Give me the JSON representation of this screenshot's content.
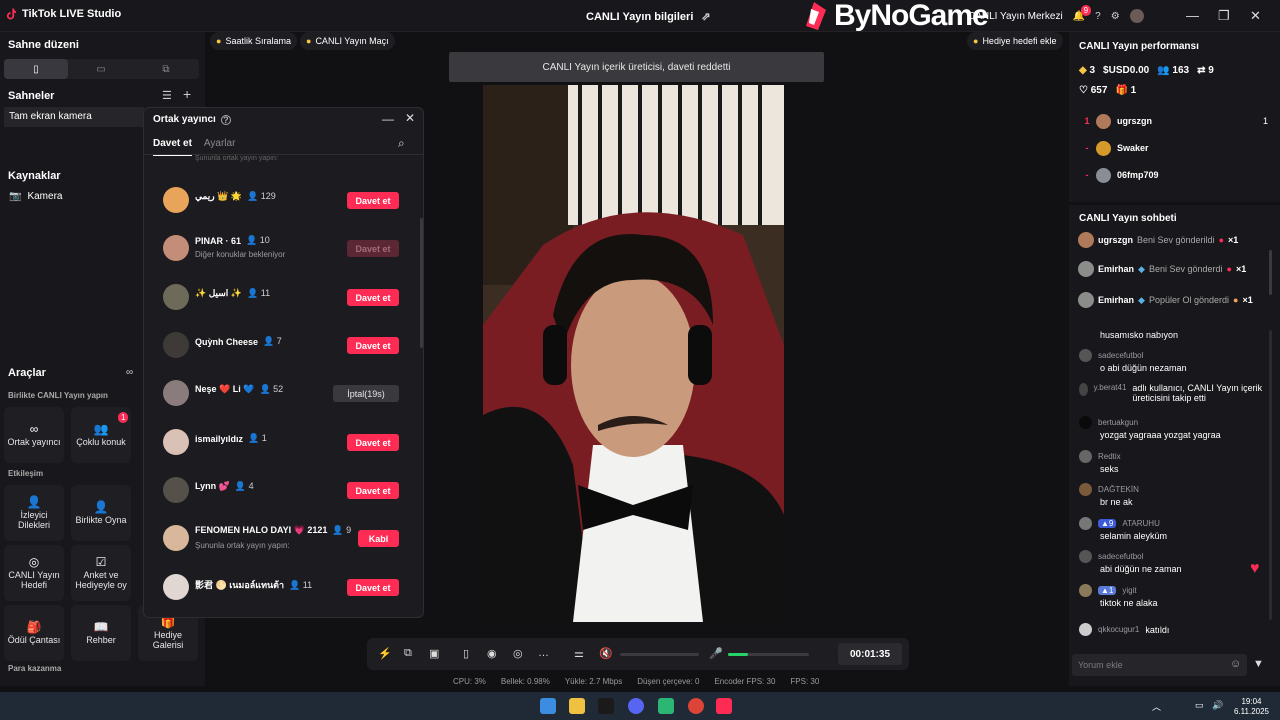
{
  "app": {
    "title": "TikTok LIVE Studio"
  },
  "header": {
    "center_title": "CANLI Yayın bilgileri",
    "brand": "ByNoGame",
    "live_center": "CANLI Yayın Merkezi",
    "notification_count": "9"
  },
  "left": {
    "scene_layout_title": "Sahne düzeni",
    "scenes_title": "Sahneler",
    "scene_item": "Tam ekran kamera",
    "sources_title": "Kaynaklar",
    "source_item": "Kamera",
    "tools_title": "Araçlar",
    "tools_hint": "∞",
    "live_together_title": "Birlikte CANLI Yayın yapın",
    "engagement_title": "Etkileşim",
    "earn_title": "Para kazanma",
    "tools": {
      "cohost": "Ortak yayıncı",
      "multi_guest": "Çoklu konuk",
      "multi_guest_badge": "1",
      "viewer_requests": "İzleyici Dilekleri",
      "play_together": "Birlikte Oyna",
      "live_goal": "CANLI Yayın Hedefi",
      "poll_gift": "Anket ve Hediyeyle oy",
      "reward_bag": "Ödül Çantası",
      "guide": "Rehber",
      "gift_gallery": "Hediye Galerisi"
    }
  },
  "top_pills": {
    "hourly_rank": "Saatlik Sıralama",
    "live_match": "CANLI Yayın Maçı",
    "gift_goal": "Hediye hedefi ekle"
  },
  "toast": "CANLI Yayın içerik üreticisi, daveti reddetti",
  "cohost_modal": {
    "title": "Ortak yayıncı",
    "tabs": [
      "Davet et",
      "Ayarlar"
    ],
    "partial_top_sub": "Şununla ortak yayın yapın:",
    "rows": [
      {
        "name": "ريمي 👑 🌟",
        "count": "129",
        "button": "Davet et",
        "sub": "",
        "state": "invite"
      },
      {
        "name": "PINAR · 61",
        "count": "10",
        "button": "Davet et",
        "sub": "Diğer konuklar bekleniyor",
        "state": "disabled"
      },
      {
        "name": "✨ اسيل ✨",
        "count": "11",
        "button": "Davet et",
        "sub": "",
        "state": "invite"
      },
      {
        "name": "Quỳnh Cheese",
        "count": "7",
        "button": "Davet et",
        "sub": "",
        "state": "invite"
      },
      {
        "name": "Neşe ❤️ Li 💙",
        "count": "52",
        "button": "İptal(19s)",
        "sub": "",
        "state": "cancel"
      },
      {
        "name": "ismailyıldız",
        "count": "1",
        "button": "Davet et",
        "sub": "",
        "state": "invite"
      },
      {
        "name": "Lynn 💕",
        "count": "4",
        "button": "Davet et",
        "sub": "",
        "state": "invite"
      },
      {
        "name": "FENOMEN HALO DAYI 💗 2121",
        "count": "9",
        "button": "Kabl",
        "sub": "Şununla ortak yayın yapın:",
        "state": "accept"
      },
      {
        "name": "影君 🌕 เนมอล์แทนต้า",
        "count": "11",
        "button": "Davet et",
        "sub": "",
        "state": "invite"
      }
    ]
  },
  "performance": {
    "title": "CANLI Yayın performansı",
    "diamonds": "3",
    "usd": "USD0.00",
    "viewers": "163",
    "shares": "9",
    "likes": "657",
    "gifts": "1",
    "leaderboard": [
      {
        "rank": "1",
        "name": "ugrszgn",
        "value": "1"
      },
      {
        "rank": "-",
        "name": "Swaker",
        "value": ""
      },
      {
        "rank": "-",
        "name": "06fmp709",
        "value": ""
      }
    ]
  },
  "chat": {
    "title": "CANLI Yayın sohbeti",
    "gift_rows": [
      {
        "user": "ugrszgn",
        "text": "Beni Sev gönderildi",
        "mult": "×1"
      },
      {
        "user": "Emirhan",
        "text": "Beni Sev gönderdi",
        "mult": "×1"
      },
      {
        "user": "Emirhan",
        "text": "Popüler Ol gönderdi",
        "mult": "×1"
      }
    ],
    "messages": [
      {
        "user": "",
        "text": "husamısko nabıyon",
        "badge": ""
      },
      {
        "user": "sadecefutbol",
        "text": "o abi düğün nezaman",
        "badge": ""
      },
      {
        "user": "y.berat41",
        "text": "adlı kullanıcı, CANLI Yayın içerik üreticisini takip etti",
        "badge": ""
      },
      {
        "user": "bertuakgun",
        "text": "yozgat yagraaa yozgat yagraa",
        "badge": ""
      },
      {
        "user": "Redtix",
        "text": "seks",
        "badge": ""
      },
      {
        "user": "DAĞTEKİN",
        "text": "br ne ak",
        "badge": ""
      },
      {
        "user": "ATARUHU",
        "text": "selamin aleyküm",
        "badge": "9"
      },
      {
        "user": "sadecefutbol",
        "text": "abi düğün ne zaman",
        "badge": ""
      },
      {
        "user": "yigit",
        "text": "tiktok ne alaka",
        "badge": "1"
      },
      {
        "user": "qkkocugur1",
        "text": "katıldı",
        "badge": ""
      }
    ],
    "input_placeholder": "Yorum ekle"
  },
  "controls": {
    "timer": "00:01:35",
    "mic_level": 0.25
  },
  "stats": {
    "cpu": "CPU: 3%",
    "bitrate_loss": "Bellek: 0.98%",
    "upload": "Yükle: 2.7 Mbps",
    "dropped": "Düşen çerçeve: 0",
    "encoder_fps": "Encoder FPS: 30",
    "fps": "FPS: 30"
  },
  "taskbar": {
    "time": "19:04",
    "date": "6.11.2025"
  },
  "colors": {
    "accent": "#fe2c55",
    "panel": "#18181c",
    "green": "#25d366"
  }
}
